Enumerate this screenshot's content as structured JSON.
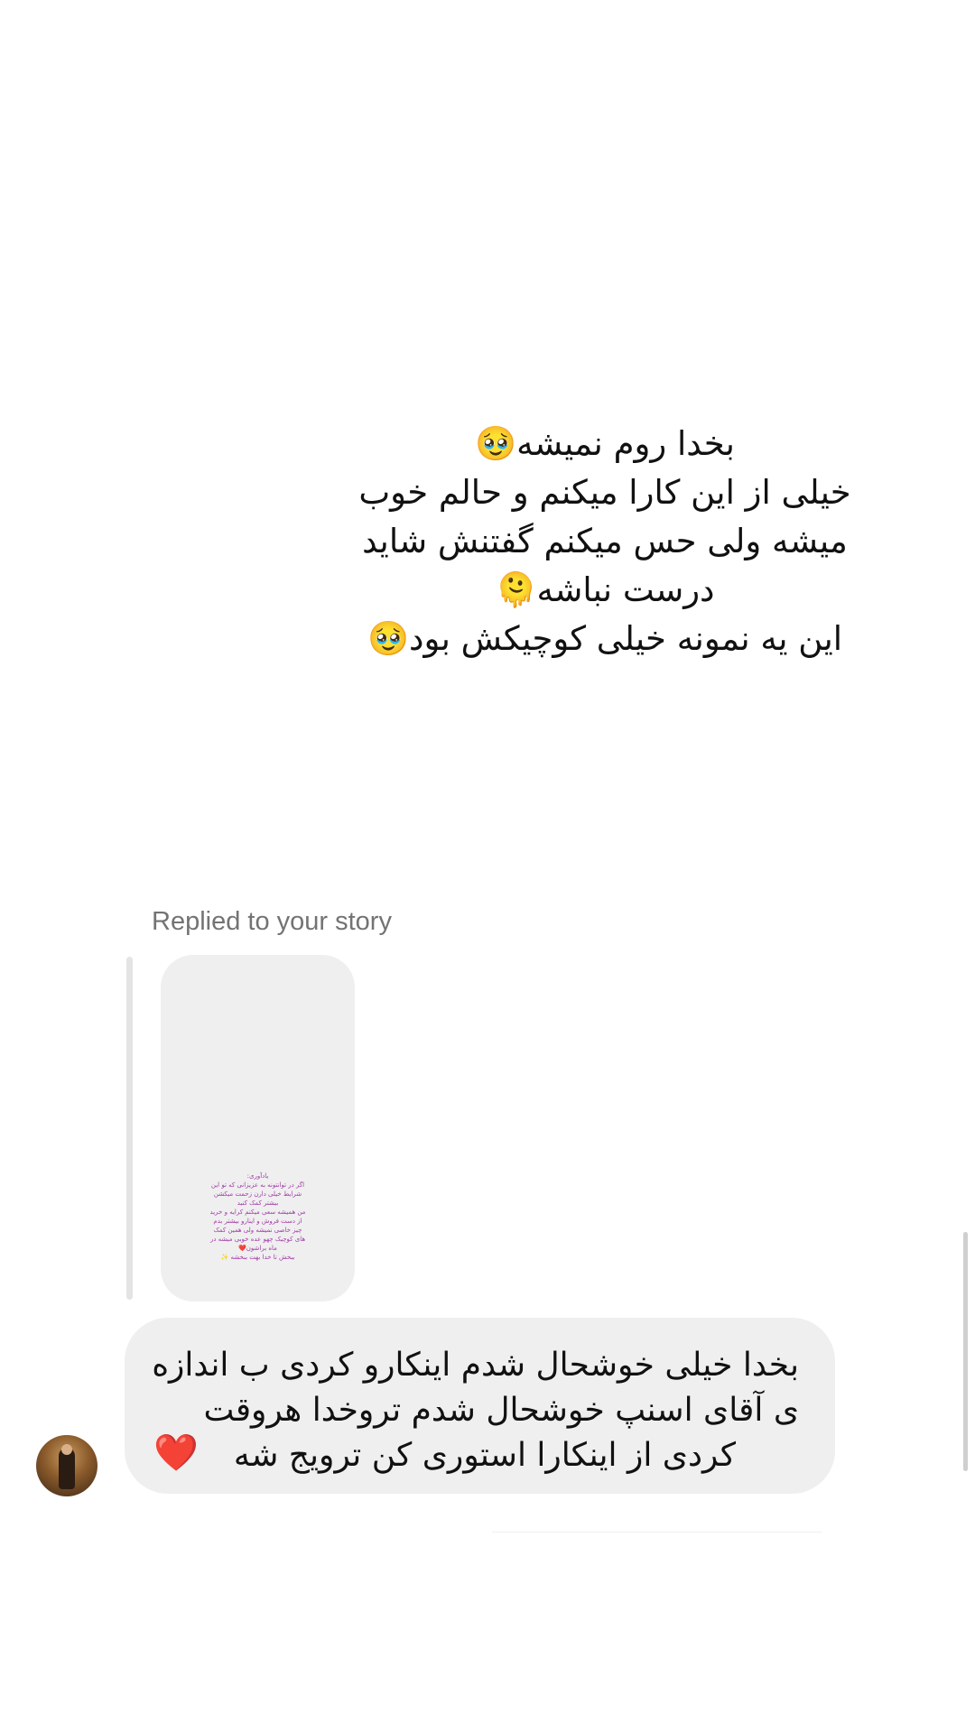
{
  "story": {
    "lines": [
      "بخدا روم نمیشه🥹",
      "خیلی از این کارا میکنم و حالم خوب",
      "میشه ولی حس میکنم گفتنش شاید",
      "درست نباشه🫠",
      "این یه نمونه خیلی کوچیکش بود🥹"
    ]
  },
  "reply": {
    "label": "Replied to your story",
    "thumbnail_lines": [
      "یادآوری:",
      "اگر در توانتونه به عزیزانی که تو این",
      "شرایط خیلی دارن زحمت میکشن",
      "بیشتر کمک کنید",
      "من همیشه سعی میکنم کرایه و خرید",
      "از دست فروش و اینارو بیشتر بدم",
      "چیز خاصی نمیشه ولی همین کمک",
      "های کوچیک چهو عده خوبی میشه در",
      "ماه براشون❤️",
      "ببخش تا خدا بهت ببخشه ✨"
    ]
  },
  "message": {
    "lines": [
      "بخدا خیلی خوشحال شدم اینکارو کردی ب اندازه",
      "ی آقای اسنپ خوشحال شدم تروخدا هروقت",
      "کردی از اینکارا استوری کن ترویج شه"
    ],
    "heart": "❤️"
  },
  "icons": {
    "heart": "heart-icon",
    "avatar": "avatar"
  },
  "colors": {
    "bubble": "#efefef",
    "label": "#737373",
    "heart": "#e0142b",
    "thumb_text": "#a23aa8"
  }
}
